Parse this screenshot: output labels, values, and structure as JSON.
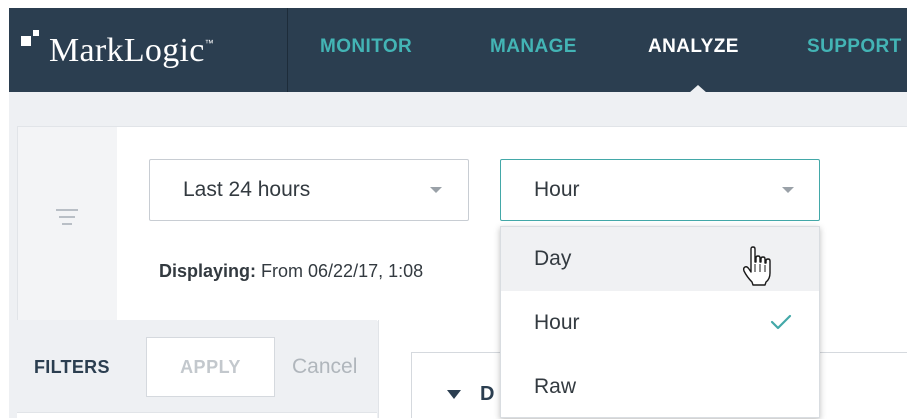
{
  "brand": {
    "name": "MarkLogic",
    "trademark": "™"
  },
  "nav": {
    "items": [
      {
        "label": "MONITOR"
      },
      {
        "label": "MANAGE"
      },
      {
        "label": "ANALYZE"
      },
      {
        "label": "SUPPORT"
      }
    ],
    "active": "ANALYZE"
  },
  "controls": {
    "range_select": {
      "value": "Last 24 hours"
    },
    "granularity_select": {
      "value": "Hour"
    },
    "displaying_label": "Displaying:",
    "displaying_text": "From  06/22/17, 1:08"
  },
  "menu": {
    "options": [
      {
        "label": "Day"
      },
      {
        "label": "Hour"
      },
      {
        "label": "Raw"
      }
    ],
    "selected": "Hour",
    "hovered": "Day"
  },
  "filters": {
    "label": "FILTERS",
    "apply_label": "APPLY",
    "cancel_label": "Cancel"
  },
  "section": {
    "title_partial": "D"
  },
  "colors": {
    "navbar": "#2b3e50",
    "accent": "#43b4b5",
    "background": "#eef0f3"
  },
  "icons": {
    "filter": "filter-lines-icon",
    "caret": "caret-down-icon",
    "check": "check-icon",
    "cursor": "hand-pointer-icon",
    "expand": "triangle-down-icon"
  }
}
